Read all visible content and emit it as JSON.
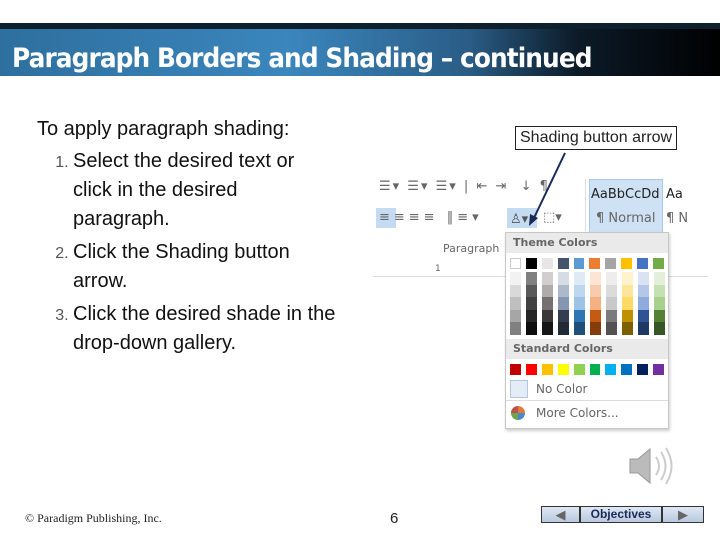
{
  "title": "Paragraph Borders and Shading – continued",
  "content": {
    "heading": "To apply paragraph shading:",
    "steps": [
      "Select the desired text or click in the desired paragraph.",
      "Click the Shading button arrow.",
      "Click the desired shade in the drop-down gallery."
    ]
  },
  "callout": "Shading button arrow",
  "ribbon": {
    "group_label": "Paragraph",
    "ruler_mark": "1",
    "style1_sample": "AaBbCcDd",
    "style1_name": "¶ Normal",
    "style2_sample": "Aa",
    "style2_name": "¶ N"
  },
  "gallery": {
    "theme_header": "Theme Colors",
    "standard_header": "Standard Colors",
    "no_color": "No Color",
    "more_colors": "More Colors...",
    "theme_colors": [
      "#ffffff",
      "#000000",
      "#e7e6e6",
      "#44546a",
      "#5b9bd5",
      "#ed7d31",
      "#a5a5a5",
      "#ffc000",
      "#4472c4",
      "#70ad47"
    ],
    "theme_tints": [
      [
        "#f2f2f2",
        "#d9d9d9",
        "#bfbfbf",
        "#a6a6a6",
        "#808080"
      ],
      [
        "#808080",
        "#595959",
        "#404040",
        "#262626",
        "#0d0d0d"
      ],
      [
        "#d0cece",
        "#aeabab",
        "#757171",
        "#3b3838",
        "#171616"
      ],
      [
        "#d6dce4",
        "#adb9ca",
        "#8496b0",
        "#333f4f",
        "#222a35"
      ],
      [
        "#deebf6",
        "#bdd7ee",
        "#9dc3e6",
        "#2e75b5",
        "#1f4e79"
      ],
      [
        "#fbe5d5",
        "#f7cbac",
        "#f4b183",
        "#c55a11",
        "#843c0b"
      ],
      [
        "#ededed",
        "#dbdbdb",
        "#c9c9c9",
        "#7b7b7b",
        "#525252"
      ],
      [
        "#fff2cc",
        "#fee599",
        "#ffd965",
        "#bf9000",
        "#7f6000"
      ],
      [
        "#dae3f3",
        "#b4c7e7",
        "#8faadc",
        "#2f5496",
        "#1f3864"
      ],
      [
        "#e2efd9",
        "#c5e0b3",
        "#a8d08d",
        "#538135",
        "#375623"
      ]
    ],
    "standard_colors": [
      "#c00000",
      "#ff0000",
      "#ffc000",
      "#ffff00",
      "#92d050",
      "#00b050",
      "#00b0f0",
      "#0070c0",
      "#002060",
      "#7030a0"
    ]
  },
  "footer": {
    "copyright": "© Paradigm Publishing, Inc.",
    "page": "6",
    "objectives": "Objectives"
  }
}
